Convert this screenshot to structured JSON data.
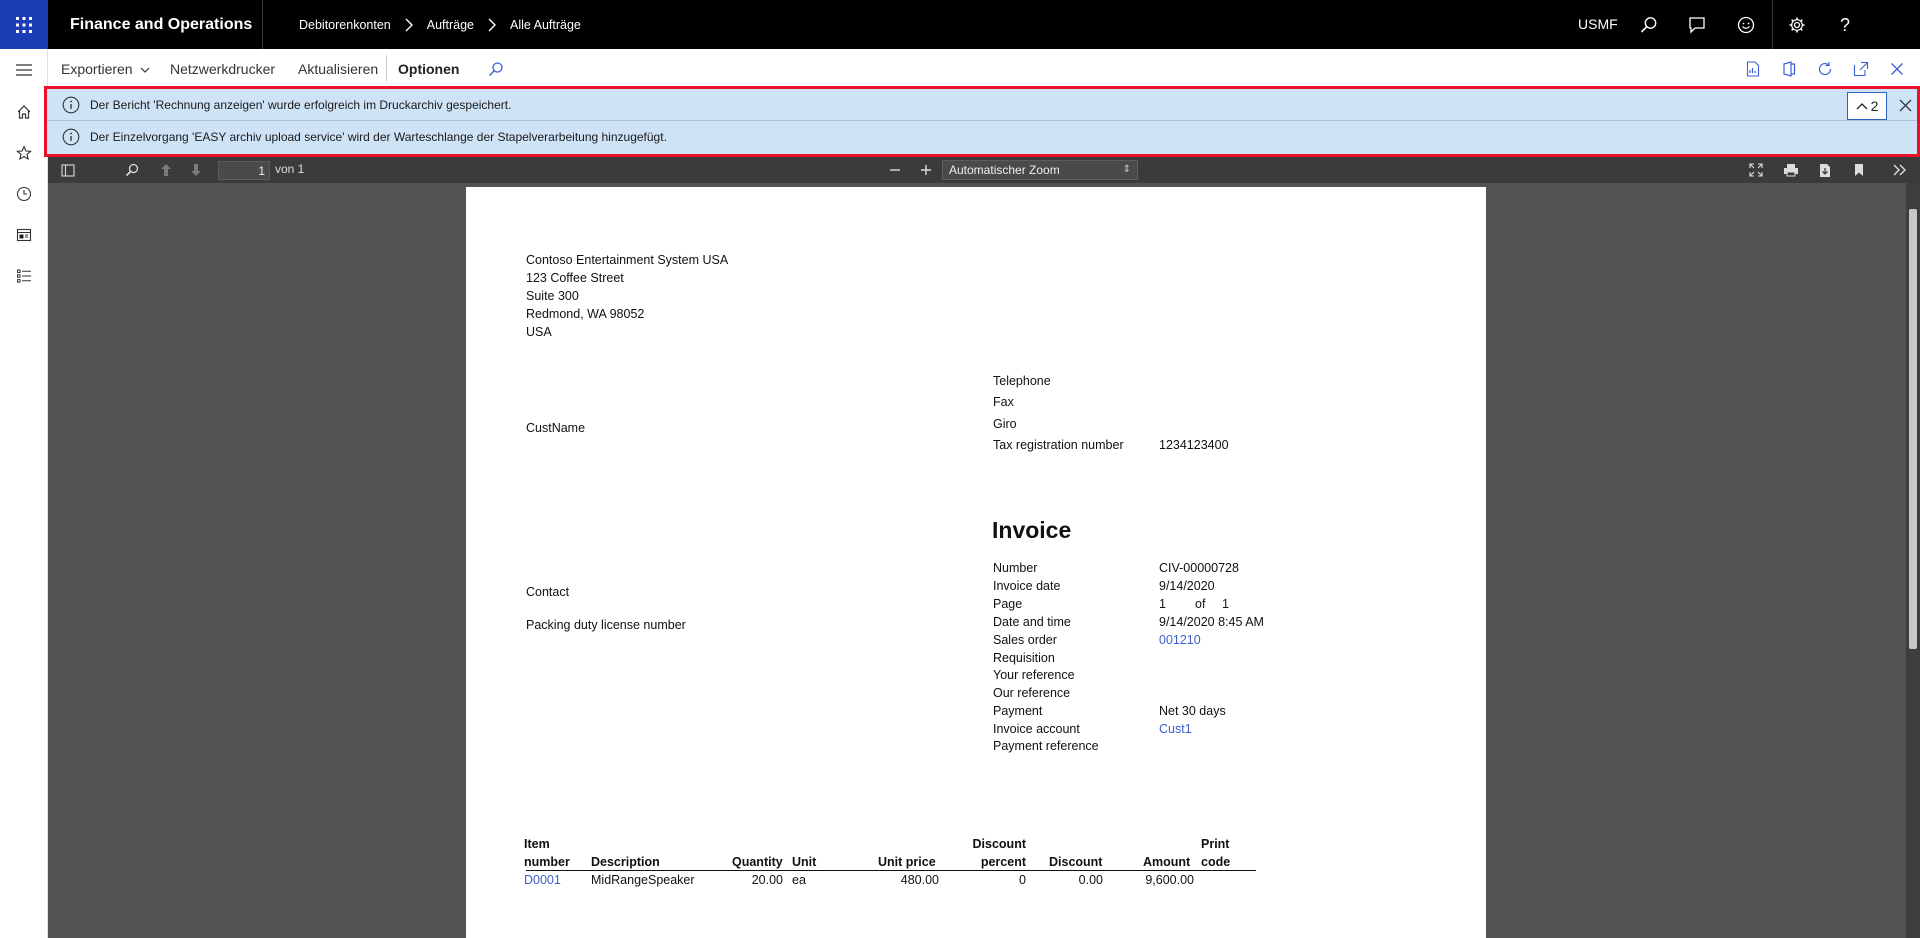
{
  "app": {
    "title": "Finance and Operations",
    "company": "USMF"
  },
  "breadcrumb": [
    "Debitorenkonten",
    "Aufträge",
    "Alle Aufträge"
  ],
  "actions": {
    "exportieren": "Exportieren",
    "netzwerkdrucker": "Netzwerkdrucker",
    "aktualisieren": "Aktualisieren",
    "optionen": "Optionen"
  },
  "messages": {
    "count": "2",
    "items": [
      "Der Bericht 'Rechnung anzeigen' wurde erfolgreich im Druckarchiv gespeichert.",
      "Der Einzelvorgang 'EASY archiv upload service' wird der Warteschlange der Stapelverarbeitung hinzugefügt."
    ]
  },
  "pdf": {
    "page_value": "1",
    "page_of": "von 1",
    "zoom": "Automatischer Zoom"
  },
  "invoice": {
    "company_lines": [
      "Contoso Entertainment System USA",
      "123 Coffee Street",
      "Suite 300",
      "Redmond, WA 98052",
      "USA"
    ],
    "contact_labels": [
      "Telephone",
      "Fax",
      "Giro",
      "Tax registration number"
    ],
    "tax_registration_number": "1234123400",
    "cust_name": "CustName",
    "title": "Invoice",
    "contact": "Contact",
    "packing_duty": "Packing duty license number",
    "header_labels": [
      "Number",
      "Invoice date",
      "Page",
      "Date and time",
      "Sales order",
      "Requisition",
      "Your reference",
      "Our reference",
      "Payment",
      "Invoice account",
      "Payment reference"
    ],
    "number": "CIV-00000728",
    "invoice_date": "9/14/2020",
    "page_num": "1",
    "page_of": "of",
    "page_total": "1",
    "date_time": "9/14/2020 8:45 AM",
    "sales_order": "001210",
    "payment": "Net 30 days",
    "invoice_account": "Cust1",
    "columns": {
      "item_top": "Item",
      "item_bottom": "number",
      "description": "Description",
      "quantity": "Quantity",
      "unit": "Unit",
      "unit_price": "Unit price",
      "discount_pct_top": "Discount",
      "discount_pct_bottom": "percent",
      "discount": "Discount",
      "amount": "Amount",
      "print_top": "Print",
      "print_bottom": "code"
    },
    "lines": [
      {
        "item": "D0001",
        "description": "MidRangeSpeaker",
        "quantity": "20.00",
        "unit": "ea",
        "unit_price": "480.00",
        "discount_percent": "0",
        "discount": "0.00",
        "amount": "9,600.00"
      }
    ]
  }
}
